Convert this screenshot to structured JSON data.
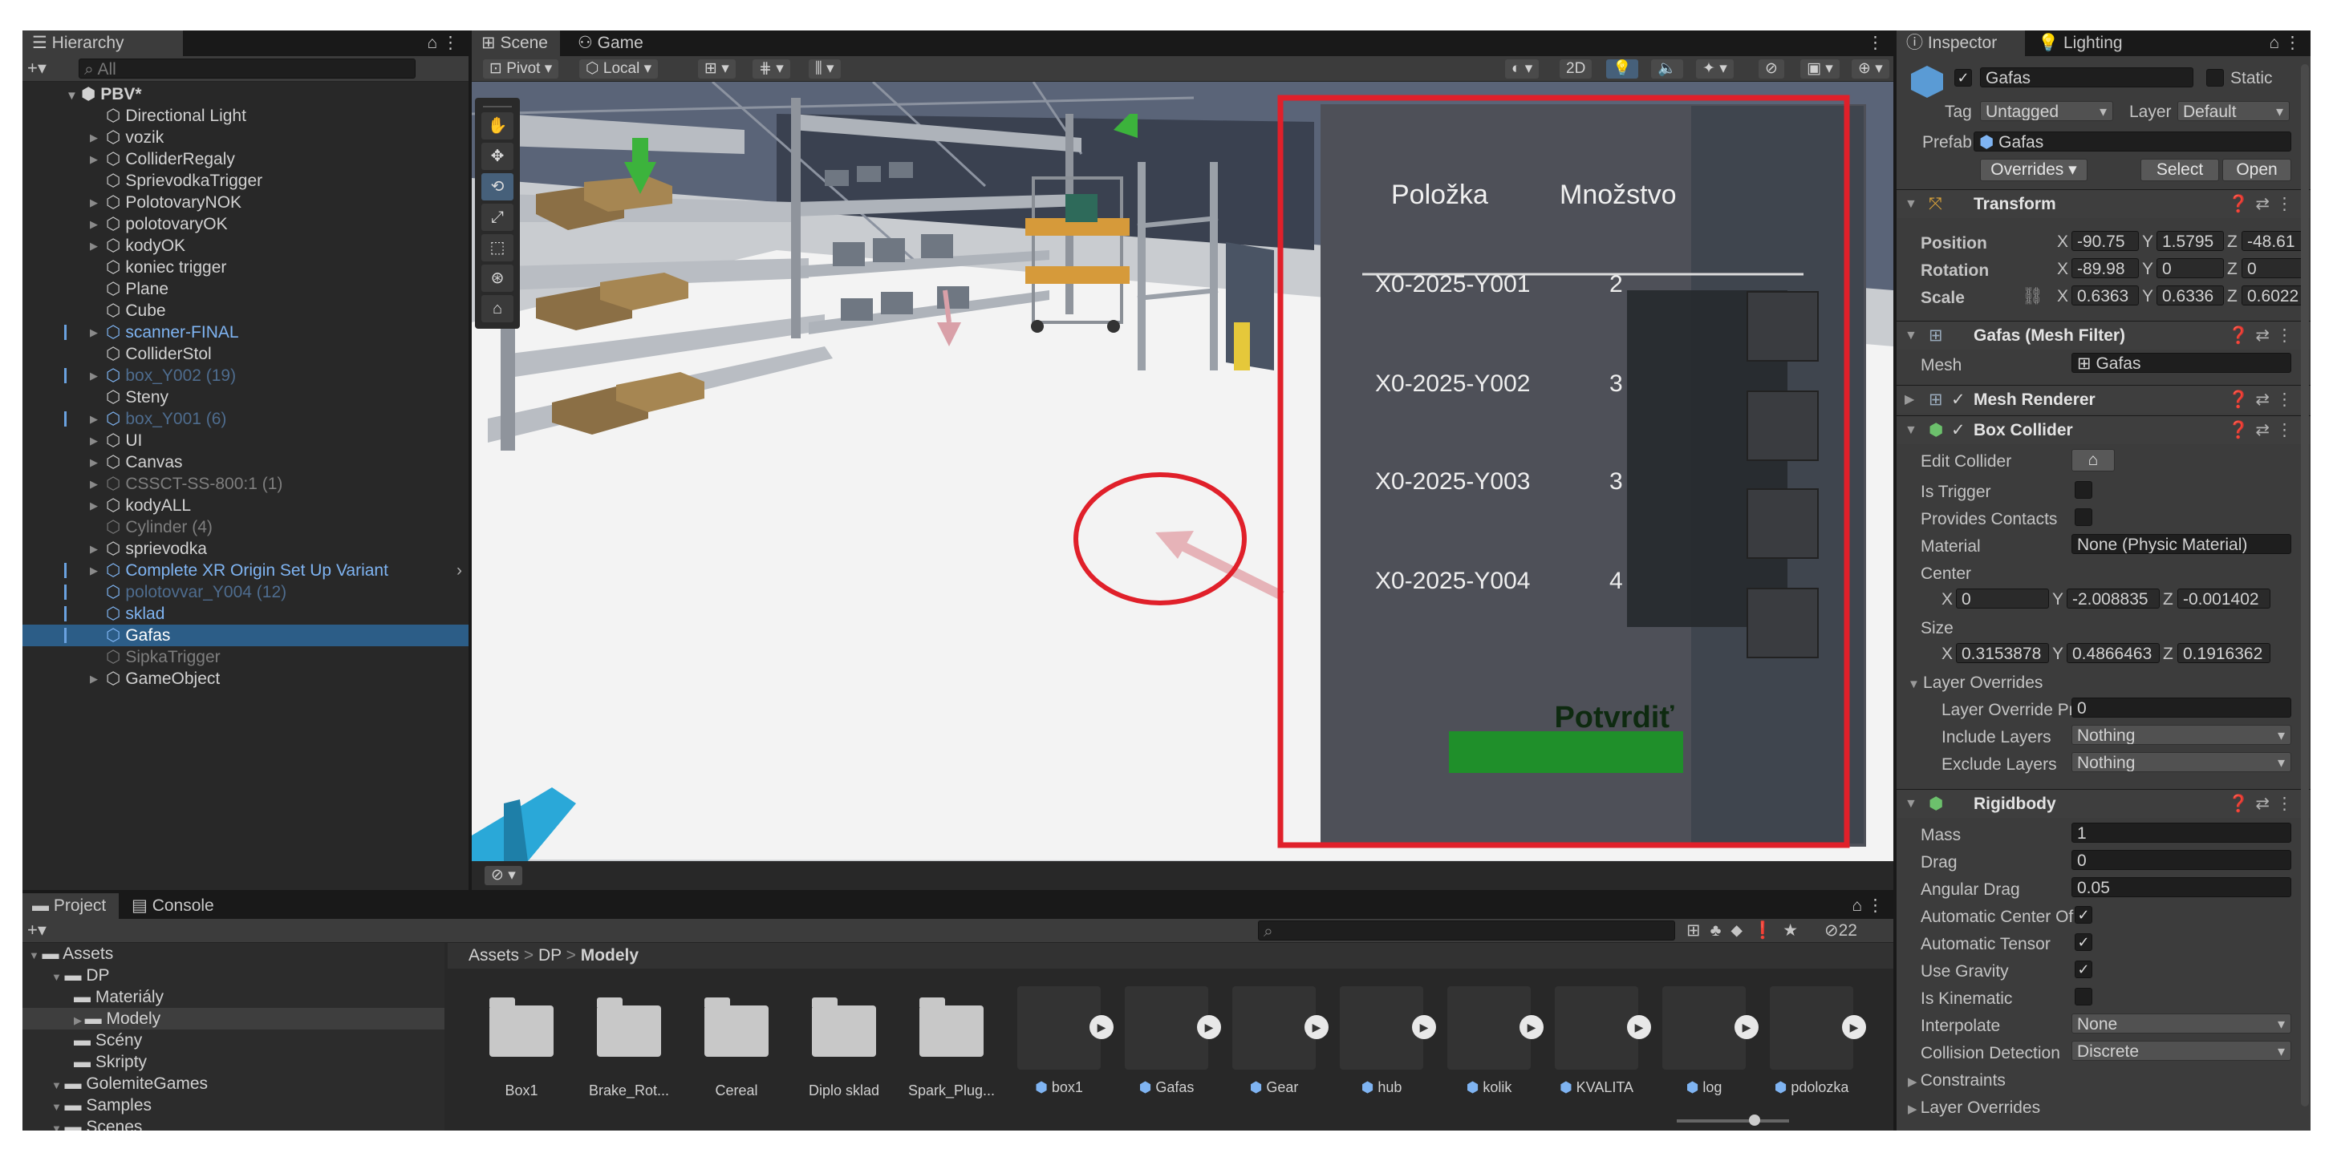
{
  "hierarchy": {
    "tab": "Hierarchy",
    "search_placeholder": "All",
    "scene": "PBV*",
    "items": [
      {
        "label": "Directional Light",
        "style": "normal",
        "exp": false
      },
      {
        "label": "vozik",
        "style": "normal",
        "exp": true
      },
      {
        "label": "ColliderRegaly",
        "style": "normal",
        "exp": true
      },
      {
        "label": "SprievodkaTrigger",
        "style": "normal",
        "exp": false
      },
      {
        "label": "PolotovaryNOK",
        "style": "normal",
        "exp": true
      },
      {
        "label": "polotovaryOK",
        "style": "normal",
        "exp": true
      },
      {
        "label": "kodyOK",
        "style": "normal",
        "exp": true
      },
      {
        "label": "koniec trigger",
        "style": "normal",
        "exp": false
      },
      {
        "label": "Plane",
        "style": "normal",
        "exp": false
      },
      {
        "label": "Cube",
        "style": "normal",
        "exp": false
      },
      {
        "label": "scanner-FINAL",
        "style": "prefab",
        "exp": true
      },
      {
        "label": "ColliderStol",
        "style": "normal",
        "exp": false
      },
      {
        "label": "box_Y002 (19)",
        "style": "prefab-dim",
        "exp": true
      },
      {
        "label": "Steny",
        "style": "normal",
        "exp": false
      },
      {
        "label": "box_Y001 (6)",
        "style": "prefab-dim",
        "exp": true
      },
      {
        "label": "UI",
        "style": "normal",
        "exp": true
      },
      {
        "label": "Canvas",
        "style": "normal",
        "exp": true
      },
      {
        "label": "CSSCT-SS-800:1 (1)",
        "style": "dim",
        "exp": true
      },
      {
        "label": "kodyALL",
        "style": "normal",
        "exp": true
      },
      {
        "label": "Cylinder (4)",
        "style": "dim",
        "exp": false
      },
      {
        "label": "sprievodka",
        "style": "normal",
        "exp": true
      },
      {
        "label": "Complete XR Origin Set Up Variant",
        "style": "prefab",
        "exp": true
      },
      {
        "label": "polotovvar_Y004 (12)",
        "style": "prefab-dim",
        "exp": false
      },
      {
        "label": "sklad",
        "style": "prefab",
        "exp": false
      },
      {
        "label": "Gafas",
        "style": "selected",
        "exp": false
      },
      {
        "label": "SipkaTrigger",
        "style": "dim",
        "exp": false
      },
      {
        "label": "GameObject",
        "style": "normal",
        "exp": true
      }
    ]
  },
  "scene_view": {
    "tabs": [
      "Scene",
      "Game"
    ],
    "pivot": "Pivot",
    "local": "Local",
    "mode_2d": "2D",
    "ui_panel": {
      "col_item": "Položka",
      "col_qty": "Množstvo",
      "rows": [
        {
          "code": "X0-2025-Y001",
          "qty": "2"
        },
        {
          "code": "X0-2025-Y002",
          "qty": "3"
        },
        {
          "code": "X0-2025-Y003",
          "qty": "3"
        },
        {
          "code": "X0-2025-Y004",
          "qty": "4"
        }
      ],
      "confirm": "Potvrdiť"
    }
  },
  "inspector": {
    "tabs": [
      "Inspector",
      "Lighting"
    ],
    "object_name": "Gafas",
    "static_label": "Static",
    "tag_label": "Tag",
    "tag_value": "Untagged",
    "layer_label": "Layer",
    "layer_value": "Default",
    "prefab_label": "Prefab",
    "prefab_value": "Gafas",
    "overrides": "Overrides",
    "select": "Select",
    "open": "Open",
    "transform": {
      "title": "Transform",
      "position_label": "Position",
      "rotation_label": "Rotation",
      "scale_label": "Scale",
      "position": [
        "-90.75",
        "1.5795",
        "-48.61"
      ],
      "rotation": [
        "-89.98",
        "0",
        "0"
      ],
      "scale": [
        "0.6363",
        "0.6336",
        "0.6022"
      ]
    },
    "mesh_filter": {
      "title": "Gafas (Mesh Filter)",
      "mesh_label": "Mesh",
      "mesh_value": "Gafas"
    },
    "mesh_renderer": {
      "title": "Mesh Renderer"
    },
    "box_collider": {
      "title": "Box Collider",
      "edit_collider": "Edit Collider",
      "is_trigger": "Is Trigger",
      "provides_contacts": "Provides Contacts",
      "material_label": "Material",
      "material_value": "None (Physic Material)",
      "center_label": "Center",
      "center": [
        "0",
        "-2.008835",
        "-0.001402"
      ],
      "size_label": "Size",
      "size": [
        "0.3153878",
        "0.4866463",
        "0.1916362"
      ],
      "layer_overrides": "Layer Overrides",
      "layer_override_priority": "Layer Override Pri",
      "layer_override_priority_value": "0",
      "include_layers": "Include Layers",
      "include_value": "Nothing",
      "exclude_layers": "Exclude Layers",
      "exclude_value": "Nothing"
    },
    "rigidbody": {
      "title": "Rigidbody",
      "mass_label": "Mass",
      "mass": "1",
      "drag_label": "Drag",
      "drag": "0",
      "angular_drag_label": "Angular Drag",
      "angular_drag": "0.05",
      "auto_center": "Automatic Center Of",
      "auto_tensor": "Automatic Tensor",
      "use_gravity": "Use Gravity",
      "is_kinematic": "Is Kinematic",
      "interpolate_label": "Interpolate",
      "interpolate": "None",
      "collision_label": "Collision Detection",
      "collision": "Discrete",
      "constraints": "Constraints",
      "layer_overrides": "Layer Overrides"
    }
  },
  "project": {
    "tabs": [
      "Project",
      "Console"
    ],
    "hidden_count": "22",
    "tree": [
      {
        "label": "Assets",
        "level": 0,
        "exp": true
      },
      {
        "label": "DP",
        "level": 1,
        "exp": true
      },
      {
        "label": "Materiály",
        "level": 2,
        "exp": false
      },
      {
        "label": "Modely",
        "level": 2,
        "exp": true
      },
      {
        "label": "Scény",
        "level": 2,
        "exp": false
      },
      {
        "label": "Skripty",
        "level": 2,
        "exp": false
      },
      {
        "label": "GolemiteGames",
        "level": 1,
        "exp": true
      },
      {
        "label": "Samples",
        "level": 1,
        "exp": true
      },
      {
        "label": "Scenes",
        "level": 1,
        "exp": true
      }
    ],
    "breadcrumb": [
      "Assets",
      "DP",
      "Modely"
    ],
    "assets": [
      {
        "label": "Box1",
        "kind": "folder"
      },
      {
        "label": "Brake_Rot...",
        "kind": "folder"
      },
      {
        "label": "Cereal",
        "kind": "folder"
      },
      {
        "label": "Diplo sklad",
        "kind": "folder"
      },
      {
        "label": "Spark_Plug...",
        "kind": "folder"
      },
      {
        "label": "box1",
        "kind": "model"
      },
      {
        "label": "Gafas",
        "kind": "model"
      },
      {
        "label": "Gear",
        "kind": "model"
      },
      {
        "label": "hub",
        "kind": "model"
      },
      {
        "label": "kolik",
        "kind": "model"
      },
      {
        "label": "KVALITA",
        "kind": "model"
      },
      {
        "label": "log",
        "kind": "model"
      },
      {
        "label": "pdolozka",
        "kind": "model"
      }
    ]
  },
  "colors": {
    "highlight_red": "#e0202a",
    "selection_blue": "#2c5d87",
    "prefab_blue": "#7fb4f2",
    "button_green": "#1f8f2a"
  }
}
